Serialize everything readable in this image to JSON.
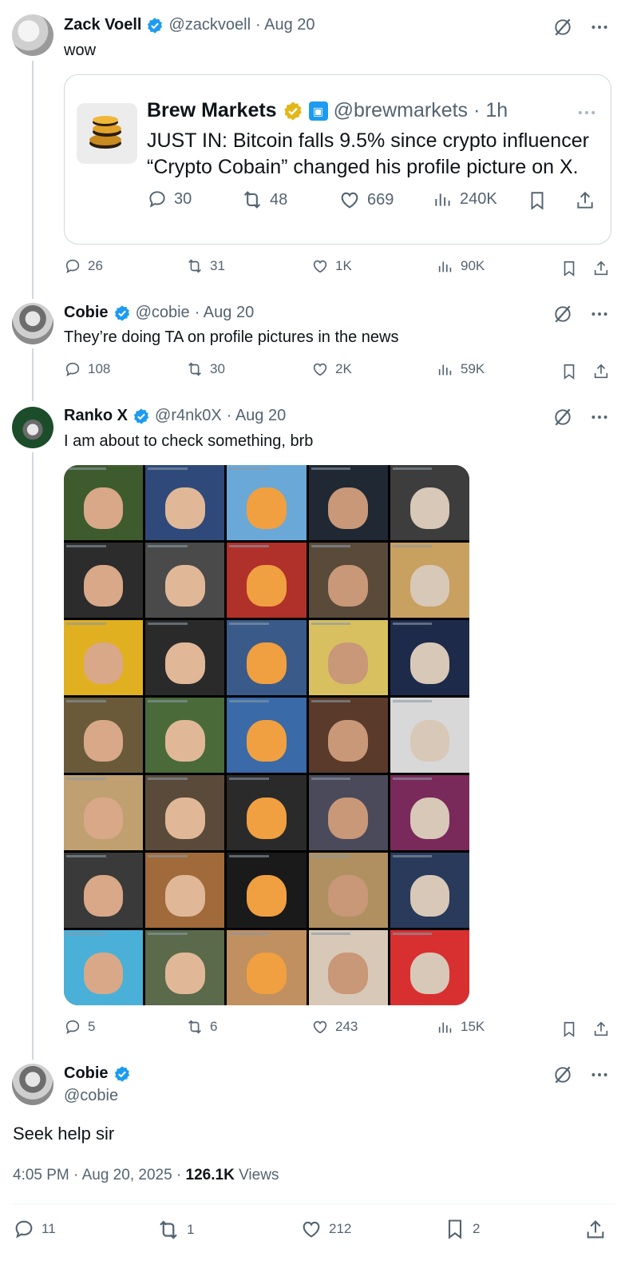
{
  "tweets": [
    {
      "name": "Zack Voell",
      "handle": "@zackvoell",
      "date": "· Aug 20",
      "text": "wow",
      "quote": {
        "name": "Brew Markets",
        "handle": "@brewmarkets",
        "date": "· 1h",
        "text_line1": "JUST IN: Bitcoin falls 9.5% since crypto influencer",
        "text_line2": "“Crypto Cobain” changed his profile picture on X.",
        "replies": "30",
        "reposts": "48",
        "likes": "669",
        "views": "240K"
      },
      "replies": "26",
      "reposts": "31",
      "likes": "1K",
      "views": "90K"
    },
    {
      "name": "Cobie",
      "handle": "@cobie",
      "date": "· Aug 20",
      "text": "They’re doing TA on profile pictures in the news",
      "replies": "108",
      "reposts": "30",
      "likes": "2K",
      "views": "59K"
    },
    {
      "name": "Ranko X",
      "handle": "@r4nk0X",
      "date": "· Aug 20",
      "text": "I am about to check something, brb",
      "replies": "5",
      "reposts": "6",
      "likes": "243",
      "views": "15K"
    }
  ],
  "main": {
    "name": "Cobie",
    "handle": "@cobie",
    "text": "Seek help sir",
    "time": "4:05 PM · Aug 20, 2025 · ",
    "views_count": "126.1K",
    "views_label": " Views",
    "replies": "11",
    "reposts": "1",
    "likes": "212",
    "bookmarks": "2"
  },
  "colors": {
    "verified_blue": "#1d9bf0",
    "verified_gold": "#e2b719",
    "muted": "#536471"
  },
  "icons": [
    "grok-icon",
    "more-icon",
    "reply-icon",
    "repost-icon",
    "like-icon",
    "views-icon",
    "bookmark-icon",
    "share-icon"
  ]
}
